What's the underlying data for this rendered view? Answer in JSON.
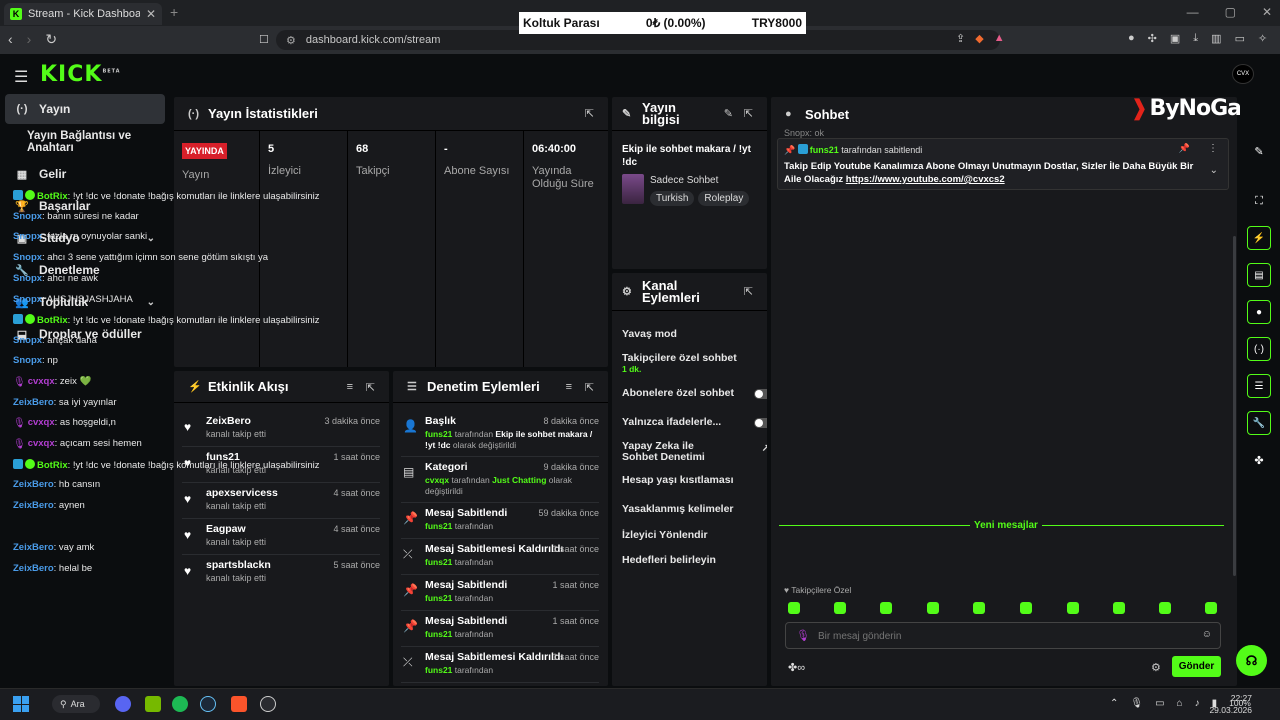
{
  "browser": {
    "tab_title": "Stream - Kick Dashboard",
    "tab_close": "✕",
    "new_tab": "+",
    "url": "dashboard.kick.com/stream",
    "ticker": {
      "label": "Koltuk Parası",
      "value": "0₺ (0.00%)",
      "target": "TRY8000"
    },
    "win_controls": [
      "—",
      "▢",
      "✕"
    ]
  },
  "kick": {
    "logo": "KICK",
    "logo_sup": "BETA",
    "avatar": "CVX"
  },
  "sidebar": {
    "items": [
      {
        "label": "Yayın",
        "icon": "(·)"
      },
      {
        "label": "Yayın Bağlantısı ve Anahtarı",
        "icon": ""
      },
      {
        "label": "Gelir",
        "icon": "▦"
      },
      {
        "label": "Başarılar",
        "icon": "🏆"
      },
      {
        "label": "Stüdyo",
        "icon": "▣"
      },
      {
        "label": "Denetleme",
        "icon": "🔧"
      },
      {
        "label": "Topluluk",
        "icon": "👥"
      },
      {
        "label": "Droplar ve ödüller",
        "icon": "⬓"
      }
    ]
  },
  "stats": {
    "title": "Yayın İstatistikleri",
    "live_badge": "YAYINDA",
    "cols": [
      {
        "value": "",
        "label": "Yayın"
      },
      {
        "value": "5",
        "label": "İzleyici"
      },
      {
        "value": "68",
        "label": "Takipçi"
      },
      {
        "value": "-",
        "label": "Abone Sayısı"
      },
      {
        "value": "06:40:00",
        "label": "Yayında Olduğu Süre"
      }
    ]
  },
  "stream_info": {
    "title": "Yayın bilgisi",
    "stream_title": "Ekip ile sohbet makara / !yt !dc",
    "category": "Sadece Sohbet",
    "tags": [
      "Turkish",
      "Roleplay"
    ]
  },
  "channel_actions": {
    "title": "Kanal Eylemleri",
    "items": [
      {
        "label": "Yavaş mod",
        "type": "chevron",
        "sub": ""
      },
      {
        "label": "Takipçilere özel sohbet",
        "type": "chevron",
        "sub": "1 dk."
      },
      {
        "label": "Abonelere özel sohbet",
        "type": "toggle",
        "sub": ""
      },
      {
        "label": "Yalnızca ifadelerle...",
        "type": "toggle",
        "sub": ""
      },
      {
        "label": "Yapay Zeka ile Sohbet Denetimi",
        "type": "external",
        "sub": ""
      },
      {
        "label": "Hesap yaşı kısıtlaması",
        "type": "chevron",
        "sub": ""
      },
      {
        "label": "Yasaklanmış kelimeler",
        "type": "chevron",
        "sub": ""
      },
      {
        "label": "İzleyici Yönlendir",
        "type": "none",
        "sub": ""
      },
      {
        "label": "Hedefleri belirleyin",
        "type": "chevron",
        "sub": ""
      }
    ]
  },
  "activity": {
    "title": "Etkinlik Akışı",
    "events": [
      {
        "name": "ZeixBero",
        "sub": "kanalı takip etti",
        "time": "3 dakika önce"
      },
      {
        "name": "funs21",
        "sub": "kanalı takip etti",
        "time": "1 saat önce"
      },
      {
        "name": "apexservicess",
        "sub": "kanalı takip etti",
        "time": "4 saat önce"
      },
      {
        "name": "Eagpaw",
        "sub": "kanalı takip etti",
        "time": "4 saat önce"
      },
      {
        "name": "spartsblackn",
        "sub": "kanalı takip etti",
        "time": "5 saat önce"
      }
    ]
  },
  "modlog": {
    "title": "Denetim Eylemleri",
    "entries": [
      {
        "title": "Başlık",
        "time": "8 dakika önce",
        "user": "funs21",
        "mid": " tarafından ",
        "obj": "Ekip ile sohbet makara / !yt !dc",
        "tail": " olarak değiştirildi",
        "icon": "👤"
      },
      {
        "title": "Kategori",
        "time": "9 dakika önce",
        "user": "cvxqx",
        "mid": " tarafından ",
        "obj": "Just Chatting",
        "tail": " olarak değiştirildi",
        "icon": "▤"
      },
      {
        "title": "Mesaj Sabitlendi",
        "time": "59 dakika önce",
        "user": "funs21",
        "mid": " tarafından",
        "obj": "",
        "tail": "",
        "icon": "📌"
      },
      {
        "title": "Mesaj Sabitlemesi Kaldırıldı",
        "time": "1 saat önce",
        "user": "funs21",
        "mid": " tarafından",
        "obj": "",
        "tail": "",
        "icon": "⤫"
      },
      {
        "title": "Mesaj Sabitlendi",
        "time": "1 saat önce",
        "user": "funs21",
        "mid": " tarafından",
        "obj": "",
        "tail": "",
        "icon": "📌"
      },
      {
        "title": "Mesaj Sabitlendi",
        "time": "1 saat önce",
        "user": "funs21",
        "mid": " tarafından",
        "obj": "",
        "tail": "",
        "icon": "📌"
      },
      {
        "title": "Mesaj Sabitlemesi Kaldırıldı",
        "time": "1 saat önce",
        "user": "funs21",
        "mid": " tarafından",
        "obj": "",
        "tail": "",
        "icon": "⤫"
      }
    ]
  },
  "chat": {
    "title": "Sohbet",
    "top_partial": "Snopx: ok",
    "pinned_by_user": "funs21",
    "pinned_by_text": " tarafından sabitlendi",
    "pinned_text": "Takip Edip Youtube Kanalımıza Abone Olmayı Unutmayın Dostlar, Sizler İle Daha Büyük Bir Aile Olacağız ",
    "pinned_link": "https://www.youtube.com/@cvxcs2",
    "messages": [
      {
        "user": "BotRix",
        "color": "#53fc18",
        "badge": "bot",
        "text": ": !yt !dc ve !donate !bağış komutları ile linklere ulaşabilirsiniz"
      },
      {
        "user": "Snopx",
        "color": "#4a9be8",
        "badge": "",
        "text": ": banın süresi ne kadar"
      },
      {
        "user": "Snopx",
        "color": "#4a9be8",
        "badge": "",
        "text": ": fazla rp oynuyolar sanki"
      },
      {
        "user": "Snopx",
        "color": "#4a9be8",
        "badge": "",
        "text": ": ahcı 3 sene yattığım içimn son sene götüm sıkıştı ya"
      },
      {
        "user": "Snopx",
        "color": "#4a9be8",
        "badge": "",
        "text": ": ahcı ne awk"
      },
      {
        "user": "Snopx",
        "color": "#4a9be8",
        "badge": "",
        "text": ": AHSJHSJASHJAHA"
      },
      {
        "user": "BotRix",
        "color": "#53fc18",
        "badge": "bot",
        "text": ": !yt !dc ve !donate !bağış komutları ile linklere ulaşabilirsiniz"
      },
      {
        "user": "Snopx",
        "color": "#4a9be8",
        "badge": "",
        "text": ": artçak daha"
      },
      {
        "user": "Snopx",
        "color": "#4a9be8",
        "badge": "",
        "text": ": np"
      },
      {
        "user": "cvxqx",
        "color": "#b23ed1",
        "badge": "mic",
        "text": ": zeix 💚"
      },
      {
        "user": "ZeixBero",
        "color": "#4a9be8",
        "badge": "",
        "text": ": sa iyi yayınlar"
      },
      {
        "user": "cvxqx",
        "color": "#b23ed1",
        "badge": "mic",
        "text": ": as hoşgeldi,n"
      },
      {
        "user": "cvxqx",
        "color": "#b23ed1",
        "badge": "mic",
        "text": ": açıcam sesi hemen"
      },
      {
        "user": "BotRix",
        "color": "#53fc18",
        "badge": "bot",
        "text": ": !yt !dc ve !donate !bağış komutları ile linklere ulaşabilirsiniz"
      },
      {
        "user": "ZeixBero",
        "color": "#4a9be8",
        "badge": "",
        "text": ": hb cansın"
      },
      {
        "user": "ZeixBero",
        "color": "#4a9be8",
        "badge": "",
        "text": ": aynen"
      }
    ],
    "new_messages_label": "Yeni mesajlar",
    "after_messages": [
      {
        "user": "ZeixBero",
        "color": "#4a9be8",
        "text": ": vay amk"
      },
      {
        "user": "ZeixBero",
        "color": "#4a9be8",
        "text": ": helal be"
      }
    ],
    "followers_only_label": "Takipçilere Özel",
    "input_placeholder": "Bir mesaj gönderin",
    "send_label": "Gönder"
  },
  "watermark": "ByNoGame",
  "taskbar": {
    "search": "Ara",
    "battery": "100%",
    "time": "22:27",
    "date": "29.03.2026"
  },
  "colors": {
    "accent": "#53fc18",
    "live": "#d8202a",
    "panel": "#18191c"
  }
}
